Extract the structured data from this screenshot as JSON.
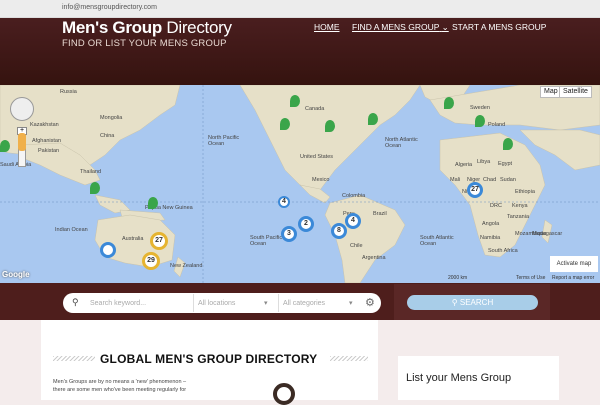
{
  "topbar": {
    "email": "info@mensgroupdirectory.com"
  },
  "header": {
    "logo_bold": "Men's Group",
    "logo_light": "Directory",
    "tagline": "FIND OR LIST YOUR MENS GROUP",
    "nav": [
      {
        "label": "HOME"
      },
      {
        "label": "FIND A MENS GROUP"
      },
      {
        "label": "START A MENS GROUP"
      }
    ]
  },
  "map": {
    "type_buttons": [
      "Map",
      "Satellite"
    ],
    "clusters": [
      "4",
      "2",
      "3",
      "8",
      "4",
      "27",
      "29"
    ],
    "labels": [
      "Russia",
      "Kazakhstan",
      "Afghanistan",
      "Pakistan",
      "Saudi Arabia",
      "Thailand",
      "Indian Ocean",
      "Papua New Guinea",
      "Australia",
      "New Zealand",
      "North Pacific Ocean",
      "South Pacific Ocean",
      "North Atlantic Ocean",
      "South Atlantic Ocean",
      "Canada",
      "United States",
      "Mexico",
      "Colombia",
      "Peru",
      "Brazil",
      "Chile",
      "Argentina",
      "Sweden",
      "Poland",
      "Algeria",
      "Libya",
      "Egypt",
      "Mali",
      "Niger",
      "Chad",
      "Sudan",
      "Nigeria",
      "Ethiopia",
      "DRC",
      "Kenya",
      "Tanzania",
      "Angola",
      "Namibia",
      "South Africa",
      "Madagascar",
      "Mozambique",
      "Mongolia",
      "China"
    ],
    "footer": {
      "scale": "2000 km",
      "terms": "Terms of Use",
      "report": "Report a map error",
      "activate": "Activate map",
      "google": "Google"
    }
  },
  "search": {
    "keyword_placeholder": "Search keyword...",
    "locations": "All locations",
    "categories": "All categories",
    "button": "SEARCH"
  },
  "content": {
    "heading": "GLOBAL MEN'S GROUP DIRECTORY",
    "paragraph_line1": "Men's Groups are by no means a 'new' phenomenon –",
    "paragraph_line2": "there are some men who've been meeting regularly for"
  },
  "sidebar": {
    "heading": "List your Mens Group"
  },
  "colors": {
    "header": "#40191a",
    "map_water": "#a9c8f0",
    "land": "#e6e0c8",
    "cluster_blue": "#3b89d8",
    "cluster_yellow": "#e6b430",
    "pin_green": "#3aa54a",
    "search_button": "#a8cde8"
  }
}
